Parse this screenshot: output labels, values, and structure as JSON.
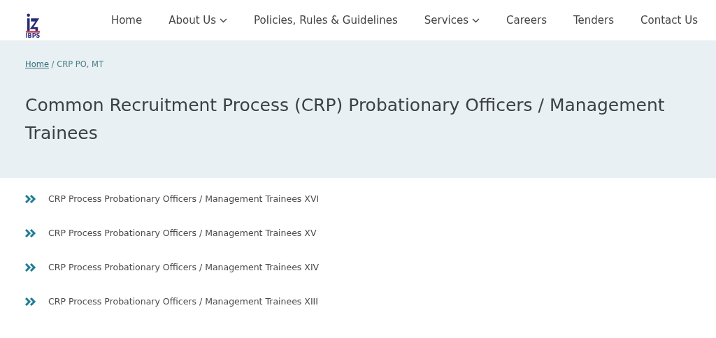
{
  "header": {
    "logo_text": "IBPS",
    "nav": [
      {
        "label": "Home",
        "has_menu": false
      },
      {
        "label": "About Us",
        "has_menu": true
      },
      {
        "label": "Policies, Rules & Guidelines",
        "has_menu": false
      },
      {
        "label": "Services",
        "has_menu": true
      },
      {
        "label": "Careers",
        "has_menu": false
      },
      {
        "label": "Tenders",
        "has_menu": false
      },
      {
        "label": "Contact Us",
        "has_menu": false
      }
    ]
  },
  "breadcrumb": {
    "link": "Home",
    "current": " / CRP PO, MT"
  },
  "title": "Common Recruitment Process (CRP) Probationary Officers / Management Trainees",
  "links": [
    "CRP Process Probationary Officers / Management Trainees XVI",
    "CRP Process Probationary Officers / Management Trainees XV",
    "CRP Process Probationary Officers / Management Trainees XIV",
    "CRP Process Probationary Officers / Management Trainees XIII"
  ]
}
